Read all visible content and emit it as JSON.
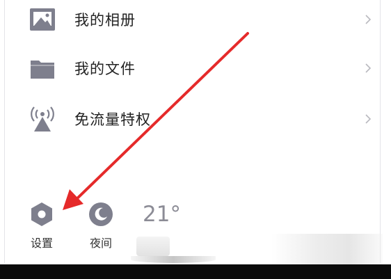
{
  "menu": {
    "items": [
      {
        "label": "我的相册",
        "icon": "photo-album-icon"
      },
      {
        "label": "我的文件",
        "icon": "folder-icon"
      },
      {
        "label": "免流量特权",
        "icon": "broadcast-antenna-icon"
      }
    ]
  },
  "bottom_bar": {
    "settings_label": "设置",
    "settings_icon": "settings-hexagon-icon",
    "night_label": "夜间",
    "night_icon": "crescent-moon-icon",
    "temperature": "21°"
  },
  "colors": {
    "icon_gray": "#7e7f8d",
    "text": "#222222",
    "chevron": "#b9b9bf",
    "arrow_red": "#e52a2a"
  }
}
